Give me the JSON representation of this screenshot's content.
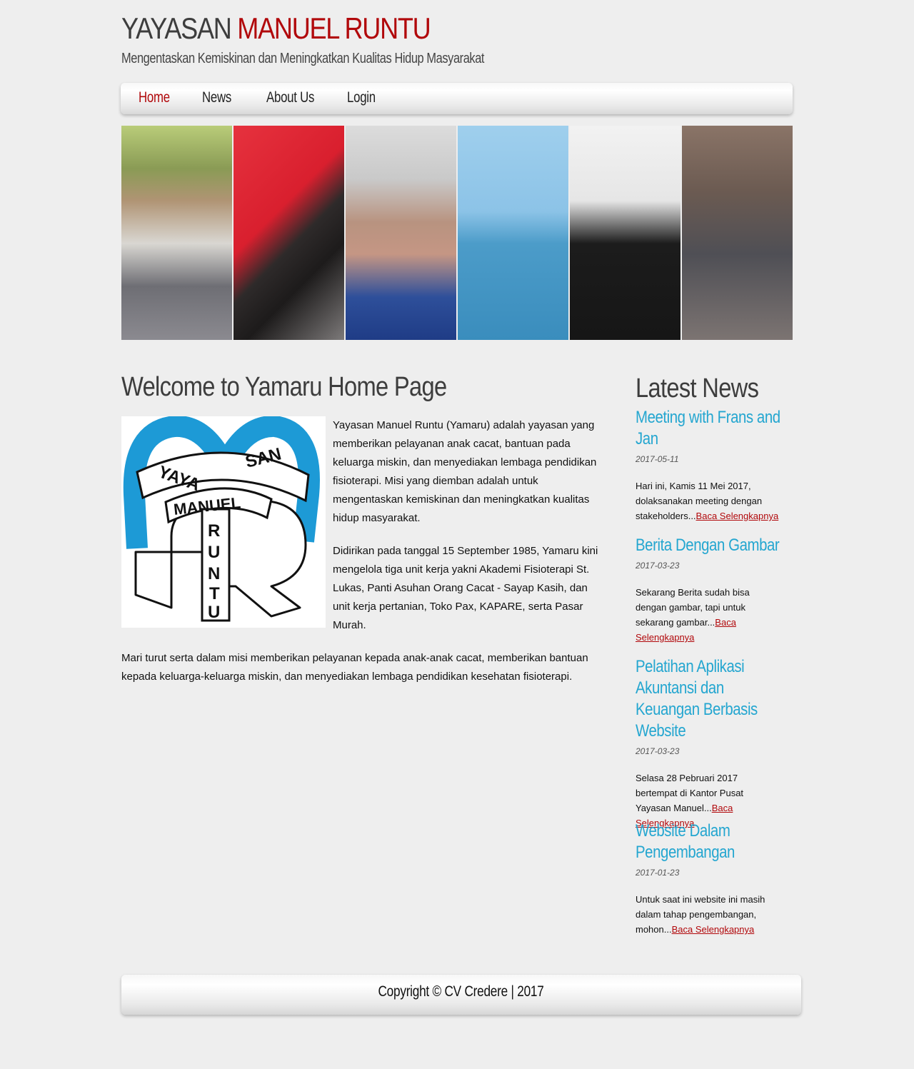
{
  "header": {
    "title_part1": "YAYASAN ",
    "title_part2": "MANUEL RUNTU",
    "tagline": "Mengentaskan Kemiskinan dan Meningkatkan Kualitas Hidup Masyarakat"
  },
  "nav": {
    "items": [
      {
        "label": "Home",
        "active": true
      },
      {
        "label": "News",
        "active": false
      },
      {
        "label": "About Us",
        "active": false
      },
      {
        "label": "Login",
        "active": false
      }
    ]
  },
  "main": {
    "title": "Welcome to Yamaru Home Page",
    "logo": {
      "text_yaya": "YAYA",
      "text_san": "SAN",
      "text_manuel": "MANUEL",
      "text_runtu": [
        "R",
        "U",
        "N",
        "T",
        "U"
      ]
    },
    "paragraphs": [
      "Yayasan Manuel Runtu (Yamaru) adalah yayasan yang memberikan pelayanan anak cacat, bantuan pada keluarga miskin, dan menyediakan lembaga pendidikan fisioterapi. Misi yang diemban adalah untuk mengentaskan kemiskinan dan meningkatkan kualitas hidup masyarakat.",
      "Didirikan pada tanggal 15 September 1985, Yamaru kini mengelola tiga unit kerja yakni Akademi Fisioterapi St. Lukas, Panti Asuhan Orang Cacat - Sayap Kasih, dan unit kerja pertanian, Toko Pax, KAPARE, serta Pasar Murah.",
      "Mari turut serta dalam misi memberikan pelayanan kepada anak-anak cacat, memberikan bantuan kepada keluarga-keluarga miskin, dan menyediakan lembaga pendidikan kesehatan fisioterapi."
    ]
  },
  "sidebar": {
    "title": "Latest News",
    "read_more_label": "Baca Selengkapnya",
    "items": [
      {
        "title": "Meeting with Frans and Jan",
        "date": "2017-05-11",
        "excerpt": "Hari ini, Kamis 11 Mei 2017, dolaksanakan meeting dengan stakeholders...",
        "link": "Baca Selengkapnya"
      },
      {
        "title": "Berita Dengan Gambar",
        "date": "2017-03-23",
        "excerpt": "Sekarang Berita sudah bisa dengan gambar, tapi untuk sekarang gambar...",
        "link": "Baca Selengkapnya"
      },
      {
        "title": "Pelatihan Aplikasi Akuntansi dan Keuangan Berbasis Website",
        "date": "2017-03-23",
        "excerpt": "Selasa 28 Pebruari 2017 bertempat di Kantor Pusat Yayasan Manuel...",
        "link": "Baca Selengkapnya"
      },
      {
        "title": "Website Dalam Pengembangan",
        "date": "2017-01-23",
        "excerpt": "Untuk saat ini website ini masih dalam tahap pengembangan, mohon...",
        "link": "Baca Selengkapnya"
      }
    ]
  },
  "footer": {
    "copyright": "Copyright © CV Credere | 2017"
  },
  "colors": {
    "brand_red": "#b1080b",
    "link_blue": "#24a6d0",
    "logo_blue": "#1d9ad6",
    "background": "#eeeeee"
  }
}
